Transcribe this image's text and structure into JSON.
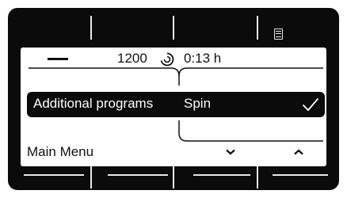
{
  "status": {
    "spin_speed": "1200",
    "spin_icon": "spin-cycle-icon",
    "time": "0:13 h"
  },
  "menu": {
    "selected_label": "Additional programs",
    "selected_value": "Spin",
    "check_icon": "check-icon"
  },
  "footer": {
    "main_menu_label": "Main Menu",
    "down_icon": "chevron-down-icon",
    "up_icon": "chevron-up-icon"
  },
  "header": {
    "list_icon": "list-icon"
  },
  "colors": {
    "bezel": "#0b0b0b",
    "screen": "#ffffff",
    "text": "#111111"
  }
}
